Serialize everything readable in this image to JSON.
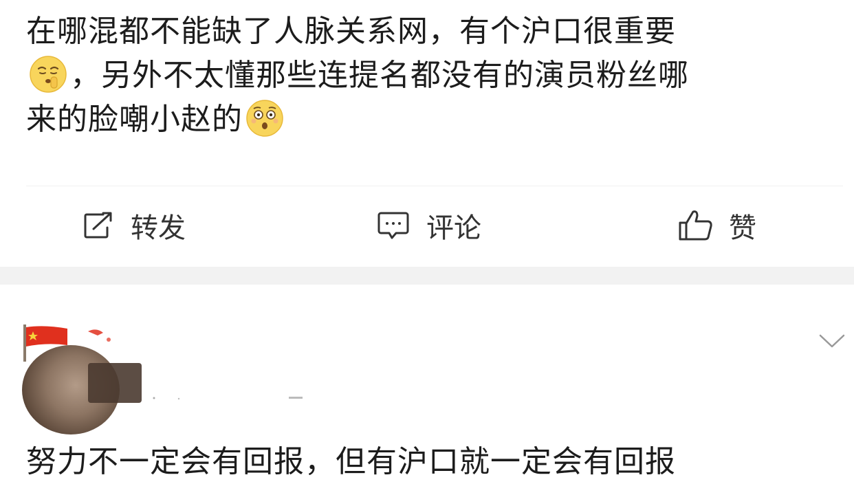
{
  "post": {
    "lines": [
      "在哪混都不能缺了人脉关系网，有个沪口很重要",
      "，另外不太懂那些连提名都没有的演员粉丝哪",
      "来的脸嘲小赵的"
    ],
    "emojis": [
      "shush-emoji",
      "shocked-emoji"
    ]
  },
  "actions": {
    "repost_label": "转发",
    "comment_label": "评论",
    "like_label": "赞"
  },
  "comment": {
    "text": "努力不一定会有回报，但有沪口就一定会有回报"
  },
  "colors": {
    "page_bg": "#ffffff",
    "separator": "#f2f2f2",
    "text": "#1c1c1c",
    "icon": "#333333",
    "flag_red": "#e0301e",
    "flag_star": "#f6d33b"
  }
}
